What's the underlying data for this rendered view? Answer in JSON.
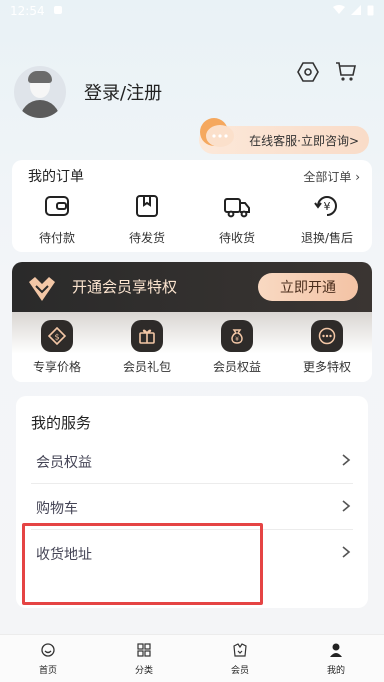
{
  "status_bar": {
    "time": "12:54"
  },
  "profile": {
    "login_label": "登录/注册"
  },
  "customer_service": {
    "label": "在线客服·立即咨询>"
  },
  "orders": {
    "title": "我的订单",
    "all_label": "全部订单",
    "items": [
      {
        "label": "待付款",
        "icon": "wallet-icon"
      },
      {
        "label": "待发货",
        "icon": "box-icon"
      },
      {
        "label": "待收货",
        "icon": "truck-icon"
      },
      {
        "label": "退换/售后",
        "icon": "refund-icon"
      }
    ]
  },
  "vip": {
    "title": "开通会员享特权",
    "button": "立即开通",
    "perks": [
      {
        "label": "专享价格",
        "icon": "price-tag-icon"
      },
      {
        "label": "会员礼包",
        "icon": "gift-icon"
      },
      {
        "label": "会员权益",
        "icon": "money-bag-icon"
      },
      {
        "label": "更多特权",
        "icon": "more-icon"
      }
    ]
  },
  "services": {
    "title": "我的服务",
    "items": [
      {
        "label": "会员权益"
      },
      {
        "label": "购物车"
      },
      {
        "label": "收货地址"
      }
    ]
  },
  "tabbar": {
    "items": [
      {
        "label": "首页",
        "icon": "home-icon"
      },
      {
        "label": "分类",
        "icon": "category-icon"
      },
      {
        "label": "会员",
        "icon": "member-icon"
      },
      {
        "label": "我的",
        "icon": "profile-icon"
      }
    ]
  }
}
